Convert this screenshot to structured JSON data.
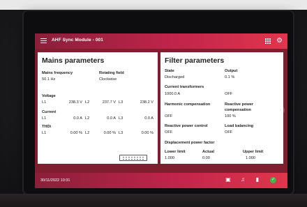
{
  "header": {
    "title": "AHF Sync Module - 001",
    "menu_icon": "hamburger-menu-icon",
    "apps_icon": "grid-apps-icon",
    "settings_icon": "gear-icon"
  },
  "mains": {
    "heading": "Mains parameters",
    "freq_label": "Mains frequency",
    "freq_value": "50.1 Hz",
    "rot_label": "Rotating field",
    "rot_value": "Clockwise",
    "voltage": {
      "label": "Voltage",
      "rows": [
        {
          "phase": "L1",
          "value": "238.3 V"
        },
        {
          "phase": "L2",
          "value": "237.7 V"
        },
        {
          "phase": "L3",
          "value": "238.2 V"
        }
      ]
    },
    "current": {
      "label": "Current",
      "rows": [
        {
          "phase": "L1",
          "value": "0.0 A"
        },
        {
          "phase": "L2",
          "value": "0.0 A"
        },
        {
          "phase": "L3",
          "value": "0.0 A"
        }
      ]
    },
    "thdi": {
      "label": "THDi",
      "rows": [
        {
          "phase": "L1",
          "value": "0.00 %"
        },
        {
          "phase": "L2",
          "value": "0.00 %"
        },
        {
          "phase": "L3",
          "value": "0.00 %"
        }
      ]
    },
    "keyboard_icon": "keyboard-icon"
  },
  "filter": {
    "heading": "Filter parameters",
    "state_label": "State",
    "state_value": "Discharged",
    "output_label": "Output",
    "output_value": "0.1 %",
    "ct_label": "Current transformers",
    "ct_value": "1000.0 A",
    "ct_status": "OFF",
    "harm_label": "Harmonic compensation",
    "harm_value": "OFF",
    "react_comp_label_1": "Reactive power",
    "react_comp_label_2": "compensation",
    "react_comp_value": "100 %",
    "react_ctrl_label": "Reactive power control",
    "react_ctrl_value": "OFF",
    "load_bal_label": "Load balancing",
    "load_bal_value": "OFF",
    "dpf_label": "Displacement power factor",
    "lower_label": "Lower limit",
    "lower_value": "1.000",
    "actual_label": "Actual",
    "actual_value": "0.00",
    "upper_label": "Upper limit",
    "upper_value": "1.000"
  },
  "status": {
    "datetime": "30/11/2022 10:31",
    "icons": [
      "documents-icon",
      "bell-icon",
      "bar-chart-icon",
      "status-ok-icon"
    ],
    "ok_color": "#3fb54a"
  },
  "colors": {
    "accent": "#c0244a",
    "accent_dark": "#8a1f3a",
    "panel": "#ffffff"
  }
}
